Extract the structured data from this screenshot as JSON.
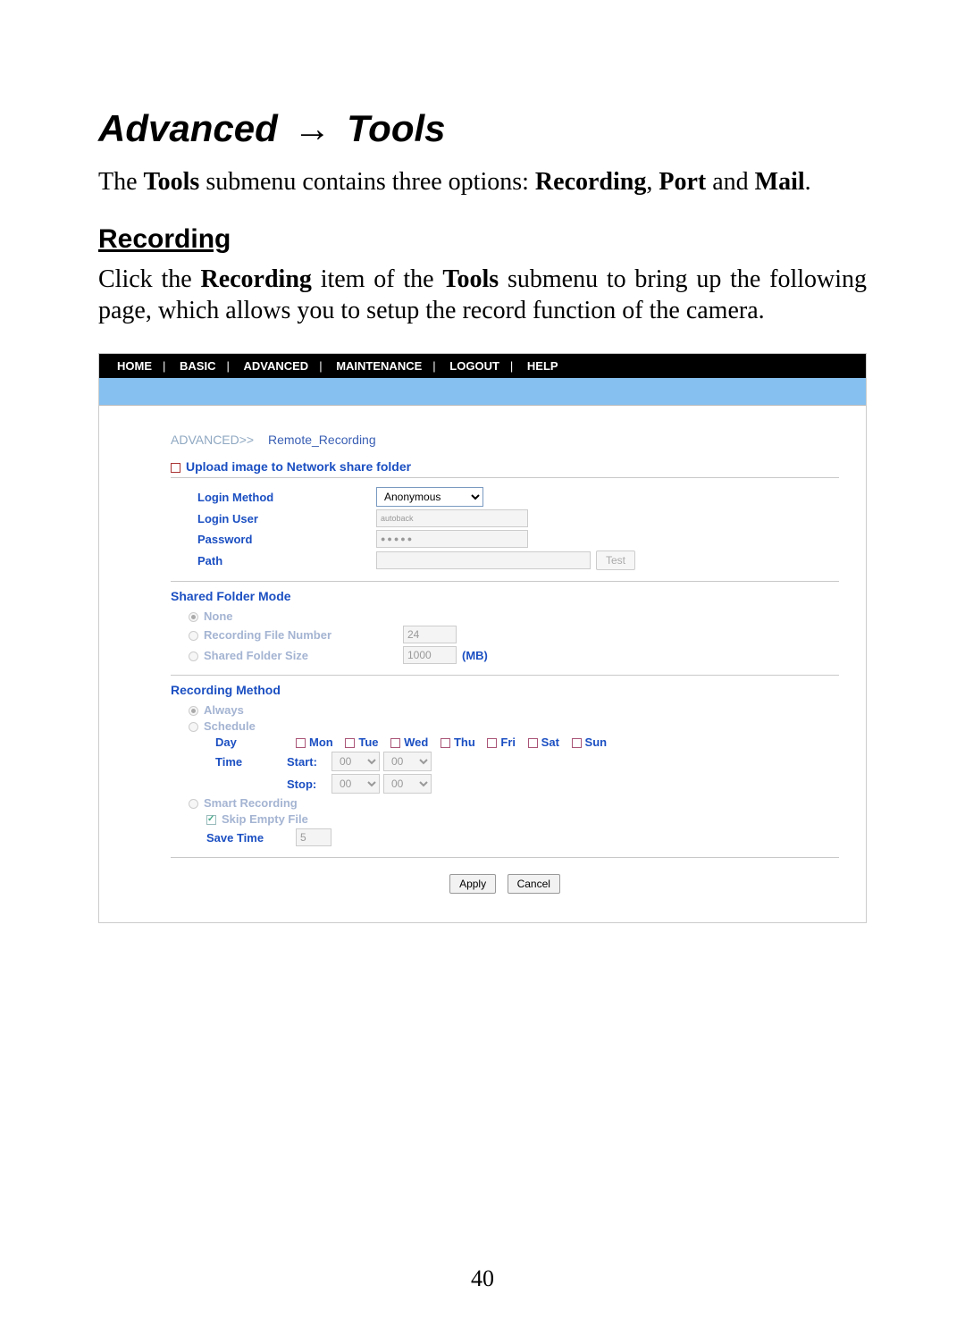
{
  "page_number": "40",
  "heading": {
    "part1": "Advanced",
    "arrow": "→",
    "part2": "Tools"
  },
  "intro": {
    "pre": "The ",
    "b1": "Tools",
    "mid1": " submenu contains three options: ",
    "b2": "Recording",
    "sep": ", ",
    "b3": "Port",
    "mid2": " and ",
    "b4": "Mail",
    "end": "."
  },
  "sub_heading": "Recording",
  "sub_intro": {
    "pre": "Click the ",
    "b1": "Recording",
    "mid1": " item of the ",
    "b2": "Tools",
    "mid2": " submenu to bring up the following page, which allows you to setup the record function of the camera."
  },
  "nav": [
    "HOME",
    "BASIC",
    "ADVANCED",
    "MAINTENANCE",
    "LOGOUT",
    "HELP"
  ],
  "breadcrumb": {
    "a": "ADVANCED>>",
    "b": "Remote_Recording"
  },
  "upload_section": {
    "title": "Upload image to Network share folder",
    "login_method_label": "Login Method",
    "login_method_value": "Anonymous",
    "login_user_label": "Login User",
    "login_user_value": "autoback",
    "password_label": "Password",
    "password_value": "●●●●●",
    "path_label": "Path",
    "path_value": "",
    "test_button": "Test"
  },
  "shared_folder": {
    "title": "Shared Folder  Mode",
    "none_label": "None",
    "rec_file_num_label": "Recording File Number",
    "rec_file_num_value": "24",
    "size_label": "Shared Folder Size",
    "size_value": "1000",
    "size_unit": "(MB)"
  },
  "recording_method": {
    "title": "Recording Method",
    "always_label": "Always",
    "schedule_label": "Schedule",
    "day_label": "Day",
    "days": [
      "Mon",
      "Tue",
      "Wed",
      "Thu",
      "Fri",
      "Sat",
      "Sun"
    ],
    "time_label": "Time",
    "start_label": "Start:",
    "stop_label": "Stop:",
    "hh_value": "00",
    "mm_value": "00",
    "smart_label": "Smart Recording",
    "skip_label": "Skip Empty File",
    "save_time_label": "Save  Time",
    "save_time_value": "5"
  },
  "buttons": {
    "apply": "Apply",
    "cancel": "Cancel"
  }
}
